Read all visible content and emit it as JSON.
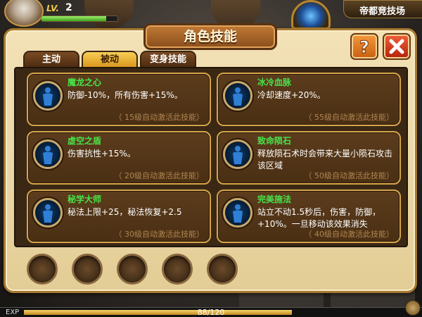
{
  "hud": {
    "level_prefix": "LV.",
    "level": "2",
    "hp_fraction": 0.85,
    "location": "帝都竞技场"
  },
  "window": {
    "title": "角色技能",
    "help_icon": "question-icon",
    "close_icon": "close-icon"
  },
  "tabs": [
    {
      "label": "主动",
      "active": false
    },
    {
      "label": "被动",
      "active": true
    },
    {
      "label": "变身技能",
      "active": false
    }
  ],
  "skills": [
    {
      "name": "魔龙之心",
      "desc": "防御-10%，所有伤害+15%。",
      "req": "（ 15级自动激活此技能）"
    },
    {
      "name": "冰冷血脉",
      "desc": "冷却速度+20%。",
      "req": "（ 55级自动激活此技能）"
    },
    {
      "name": "虚空之盾",
      "desc": "伤害抗性+15%。",
      "req": "（ 20级自动激活此技能）"
    },
    {
      "name": "致命陨石",
      "desc": "释放陨石术时会带来大量小陨石攻击该区域",
      "req": "（ 50级自动激活此技能）"
    },
    {
      "name": "秘学大师",
      "desc": "秘法上限+25，秘法恢复+2.5",
      "req": "（ 30级自动激活此技能）"
    },
    {
      "name": "完美施法",
      "desc": "站立不动1.5秒后，伤害，防御，+10%。一旦移动该效果消失",
      "req": "（ 40级自动激活此技能）"
    }
  ],
  "slots_count": 5,
  "exp": {
    "label": "EXP",
    "value": "88/120",
    "fraction": 0.7333
  },
  "colors": {
    "skill_name": "#49e34a",
    "panel": "#f3e2b7",
    "card_border": "#d6a449",
    "active_tab": "#f7cf55"
  }
}
